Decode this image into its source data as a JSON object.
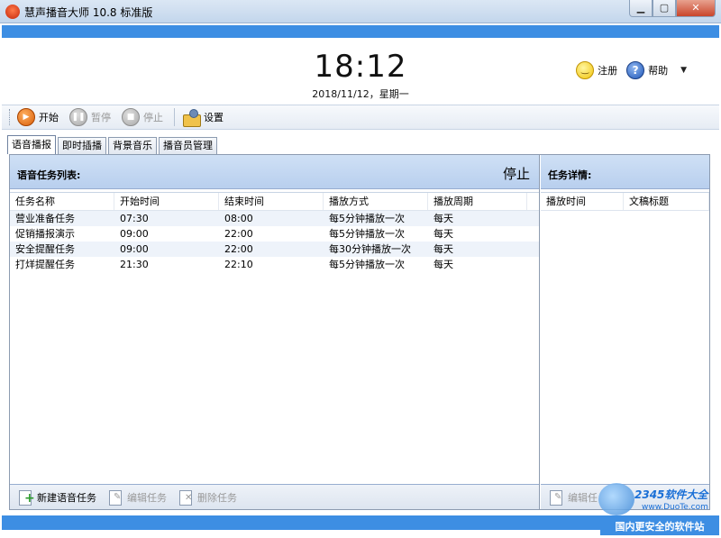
{
  "window": {
    "title": "慧声播音大师 10.8 标准版",
    "min_label": "▁",
    "max_label": "▢",
    "close_label": "✕"
  },
  "clock": {
    "time": "18:12",
    "date": "2018/11/12，星期一"
  },
  "top_actions": {
    "register_label": "注册",
    "help_label": "帮助",
    "help_glyph": "?",
    "menu_arrow": "▼"
  },
  "toolbar": {
    "start_label": "开始",
    "pause_label": "暂停",
    "stop_label": "停止",
    "settings_label": "设置"
  },
  "tabs": [
    {
      "label": "语音播报",
      "active": true
    },
    {
      "label": "即时插播",
      "active": false
    },
    {
      "label": "背景音乐",
      "active": false
    },
    {
      "label": "播音员管理",
      "active": false
    }
  ],
  "task_list": {
    "title": "语音任务列表:",
    "status": "停止",
    "columns": [
      "任务名称",
      "开始时间",
      "结束时间",
      "播放方式",
      "播放周期"
    ],
    "rows": [
      [
        "营业准备任务",
        "07:30",
        "08:00",
        "每5分钟播放一次",
        "每天"
      ],
      [
        "促销播报演示",
        "09:00",
        "22:00",
        "每5分钟播放一次",
        "每天"
      ],
      [
        "安全提醒任务",
        "09:00",
        "22:00",
        "每30分钟播放一次",
        "每天"
      ],
      [
        "打烊提醒任务",
        "21:30",
        "22:10",
        "每5分钟播放一次",
        "每天"
      ]
    ],
    "new_task_label": "新建语音任务",
    "edit_task_label": "编辑任务",
    "delete_task_label": "删除任务"
  },
  "task_detail": {
    "title": "任务详情:",
    "columns": [
      "播放时间",
      "文稿标题"
    ],
    "edit_label": "编辑任"
  },
  "watermark": {
    "brand": "2345软件大全",
    "url": "www.DuoTe.com",
    "slogan": "国内更安全的软件站"
  }
}
